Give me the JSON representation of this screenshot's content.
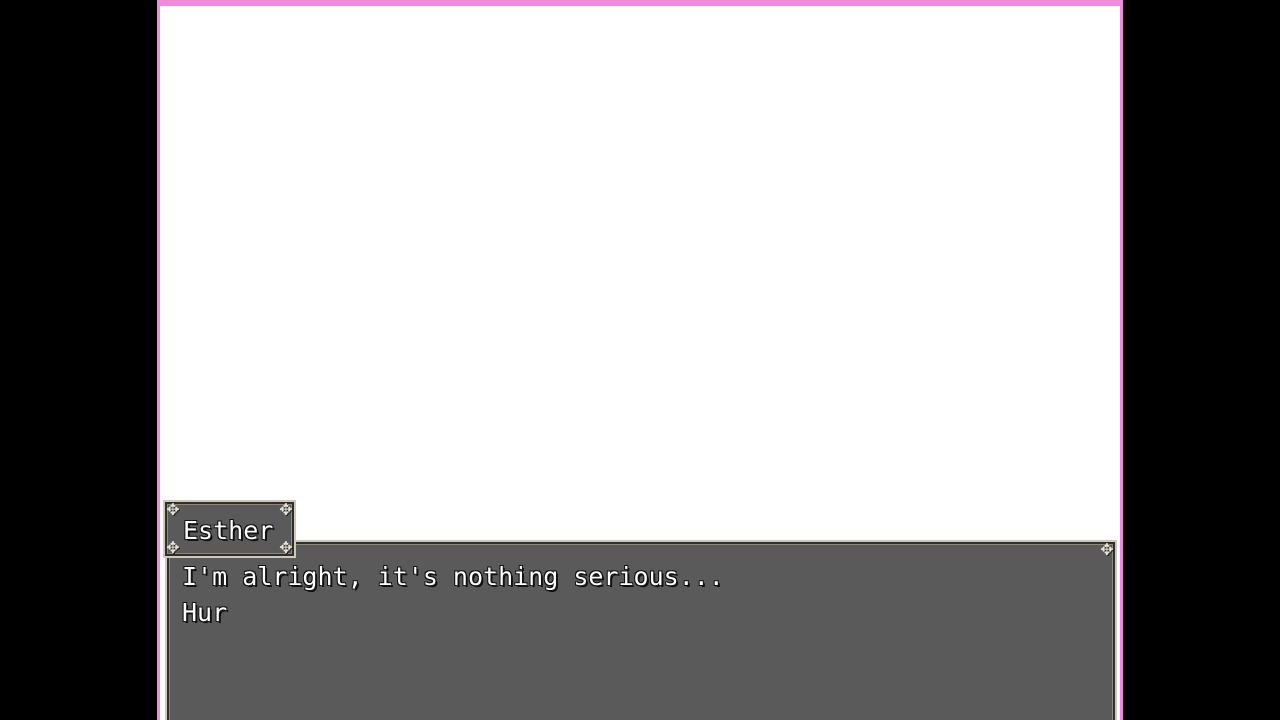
{
  "dialogue": {
    "speaker": "Esther",
    "lines": [
      "I'm alright, it's nothing serious...",
      "Hur"
    ]
  },
  "colors": {
    "screen_border": "#f08ce0",
    "screen_background": "#ffffff",
    "window_background": "#5a5a5a",
    "window_frame": "#cfc8b6",
    "text": "#ffffff"
  },
  "icons": {
    "window_corner": "ornament-icon"
  }
}
